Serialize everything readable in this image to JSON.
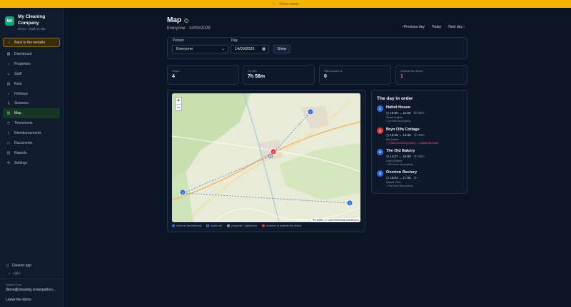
{
  "banner": {
    "icon": "info-icon",
    "text": "Demo mode"
  },
  "sidebar": {
    "brand_initials": "MC",
    "brand_name_1": "My Cleaning",
    "brand_name_2": "Company",
    "brand_sub": "Demo · back to site",
    "back_label": "Back to the website",
    "items": [
      {
        "label": "Dashboard",
        "icon": "dashboard-icon",
        "active": false
      },
      {
        "label": "Properties",
        "icon": "home-icon",
        "active": false
      },
      {
        "label": "Staff",
        "icon": "users-icon",
        "active": false
      },
      {
        "label": "Rota",
        "icon": "calendar-icon",
        "active": false
      },
      {
        "label": "Holidays",
        "icon": "sun-icon",
        "active": false
      },
      {
        "label": "Sickness",
        "icon": "thermometer-icon",
        "active": false
      },
      {
        "label": "Map",
        "icon": "map-icon",
        "active": true
      },
      {
        "label": "Timesheets",
        "icon": "clock-icon",
        "active": false
      },
      {
        "label": "Reimbursements",
        "icon": "receipt-icon",
        "active": false
      },
      {
        "label": "Documents",
        "icon": "document-icon",
        "active": false
      },
      {
        "label": "Reports",
        "icon": "chart-icon",
        "active": false
      },
      {
        "label": "Settings",
        "icon": "gear-icon",
        "active": false
      }
    ],
    "cleaner_app": "Cleaner app",
    "theme": "Light",
    "signed_in_label": "Signed in as",
    "signed_in_email": "demo@cleaning.crownparkco...",
    "leave_demo": "Leave the demo"
  },
  "header": {
    "title": "Map",
    "subtitle": "Everyone · 14/09/2026",
    "prev_day": "‹ Previous day",
    "today": "Today",
    "next_day": "Next day ›"
  },
  "filters": {
    "person_label": "Person",
    "person_value": "Everyone",
    "day_label": "Day",
    "day_value": "14/09/2026",
    "show_label": "Show"
  },
  "stats": [
    {
      "label": "Stops",
      "value": "4",
      "color": "#f1f4f8"
    },
    {
      "label": "On site",
      "value": "7h 58m",
      "color": "#f1f4f8"
    },
    {
      "label": "Still clocked in",
      "value": "0",
      "color": "#f1f4f8"
    },
    {
      "label": "Outside the fence",
      "value": "1",
      "color": "#f06a6a"
    }
  ],
  "map": {
    "zoom_in": "+",
    "zoom_out": "−",
    "attribution": "⚑ Leaflet | © OpenStreetMap contributors",
    "pins": [
      {
        "n": "1",
        "color": "#2a6ee0"
      },
      {
        "n": "2",
        "color": "#e03a3a"
      },
      {
        "n": "3",
        "color": "#2a6ee0"
      },
      {
        "n": "4",
        "color": "#2a6ee0"
      }
    ]
  },
  "legend": [
    {
      "label": "clock-in (numbered)",
      "color": "#2a6ee0"
    },
    {
      "label": "clock-out",
      "color": "#4a8ae8"
    },
    {
      "label": "property + geofence",
      "color": "#7d8a9c"
    },
    {
      "label": "clocked in outside the fence",
      "color": "#e03a3a"
    }
  ],
  "order": {
    "title": "The day in order",
    "stops": [
      {
        "n": "1",
        "color": "#2a6ee0",
        "name": "Hafod House",
        "time": "10:00 → 11:58",
        "duration": "1h 58m",
        "who": "Nesha Hughes",
        "note": "⌖ on-time the property",
        "warn": false
      },
      {
        "n": "2",
        "color": "#e03a3a",
        "name": "Bryn Olfa Cottage",
        "time": "12:28 → 13:58",
        "duration": "1h 30m",
        "who": "Ben Davies",
        "note": "⚠ 0.6km from the property — outside the fence",
        "warn": true
      },
      {
        "n": "3",
        "color": "#2a6ee0",
        "name": "The Old Bakery",
        "time": "14:27 → 16:58",
        "duration": "2h 30m",
        "who": "Carys Roberts",
        "note": "⌖ 30m from the property",
        "warn": false
      },
      {
        "n": "4",
        "color": "#2a6ee0",
        "name": "Overton Rectory",
        "time": "15:04 → 17:06",
        "duration": "2h",
        "who": "Dafydd Owen",
        "note": "⌖ 20m from the property",
        "warn": false
      }
    ]
  }
}
